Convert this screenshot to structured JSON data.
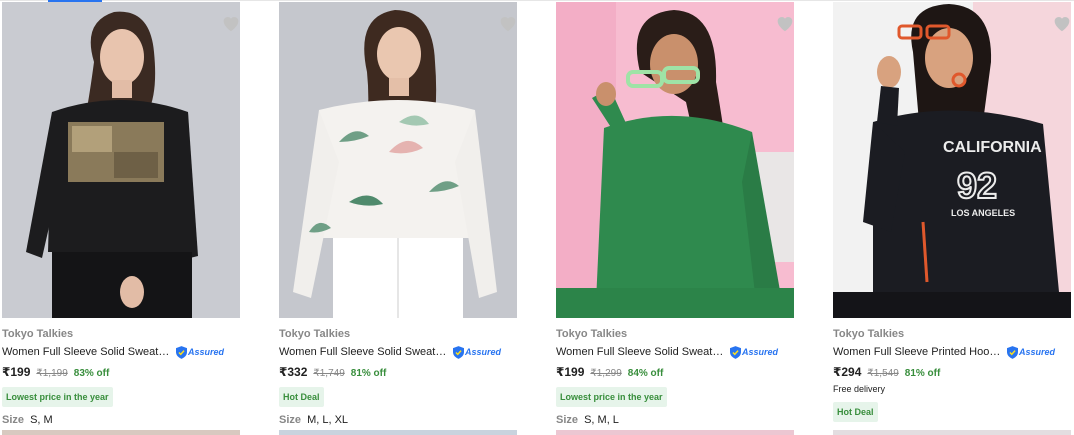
{
  "products": [
    {
      "brand": "Tokyo Talkies",
      "title": "Women Full Sleeve Solid Sweatshirt",
      "assured_label": "Assured",
      "price": "₹199",
      "mrp": "₹1,199",
      "discount": "83% off",
      "tag": "Lowest price in the year",
      "delivery": "",
      "size_label": "Size",
      "sizes": "S, M",
      "image_bg": "#ced0d6",
      "next_strip_color": "#d8c9c0"
    },
    {
      "brand": "Tokyo Talkies",
      "title": "Women Full Sleeve Solid Sweatshirt",
      "assured_label": "Assured",
      "price": "₹332",
      "mrp": "₹1,749",
      "discount": "81% off",
      "tag": "Hot Deal",
      "delivery": "",
      "size_label": "Size",
      "sizes": "M, L, XL",
      "image_bg": "#c5c7cd",
      "next_strip_color": "#c9d3de"
    },
    {
      "brand": "Tokyo Talkies",
      "title": "Women Full Sleeve Solid Sweatshirt",
      "assured_label": "Assured",
      "price": "₹199",
      "mrp": "₹1,299",
      "discount": "84% off",
      "tag": "Lowest price in the year",
      "delivery": "",
      "size_label": "Size",
      "sizes": "S, M, L",
      "image_bg": "#f7bcd0",
      "next_strip_color": "#ecc7d2"
    },
    {
      "brand": "Tokyo Talkies",
      "title": "Women Full Sleeve Printed Hooded Sweatshirt",
      "assured_label": "Assured",
      "price": "₹294",
      "mrp": "₹1,549",
      "discount": "81% off",
      "tag": "Hot Deal",
      "delivery": "Free delivery",
      "size_label": "",
      "sizes": "",
      "image_bg": "#f5d6dc",
      "next_strip_color": "#e3dde0"
    }
  ],
  "colors": {
    "accent": "#2874f0",
    "discount_green": "#388e3c",
    "tag_bg": "#e6f4ea",
    "muted_text": "#878787",
    "wishlist_heart": "#c2c2c2"
  },
  "icons": {
    "wishlist": "heart-icon",
    "assured": "shield-check-icon"
  }
}
